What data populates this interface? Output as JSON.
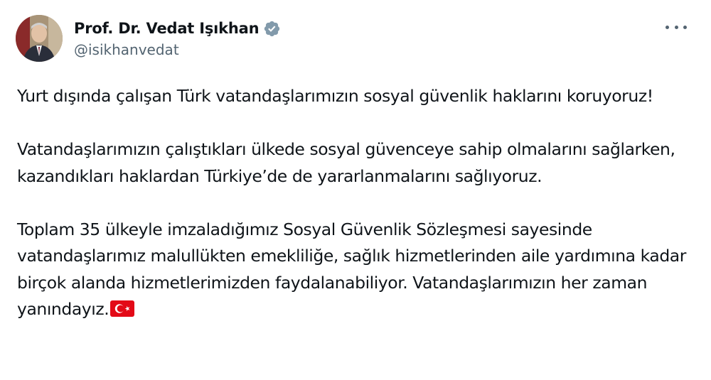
{
  "author": {
    "display_name": "Prof. Dr. Vedat Işıkhan",
    "handle": "@isikhanvedat",
    "verified_badge_icon": "verified-badge-icon"
  },
  "actions": {
    "more_icon": "more-options-icon"
  },
  "tweet": {
    "paragraph_1": "Yurt dışında çalışan Türk vatandaşlarımızın sosyal güvenlik haklarını koruyoruz!",
    "paragraph_2": "Vatandaşlarımızın çalıştıkları ülkede sosyal güvenceye sahip olmalarını sağlarken, kazandıkları haklardan Türkiye’de de yararlanmalarını sağlıyoruz.",
    "paragraph_3": "Toplam 35 ülkeyle imzaladığımız Sosyal Güvenlik Sözleşmesi sayesinde vatandaşlarımız malullükten emekliliğe, sağlık hizmetlerinden aile yardımına kadar birçok alanda hizmetlerimizden faydalanabiliyor. Vatandaşlarımızın her zaman yanındayız.",
    "emoji": "turkey-flag-icon"
  },
  "colors": {
    "text": "#0f1419",
    "secondary_text": "#536471",
    "badge": "#829aab",
    "flag_red": "#e30a17"
  }
}
